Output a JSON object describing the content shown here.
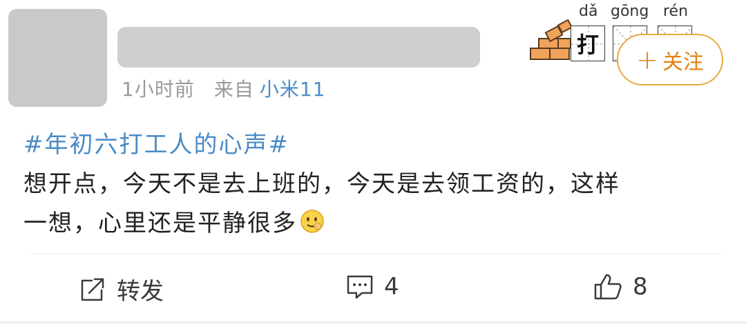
{
  "post": {
    "time": "1小时前",
    "from_label": "来自",
    "device": "小米11",
    "hashtag": "#年初六打工人的心声#",
    "text_line1": "想开点，今天不是去上班的，今天是去领工资的，这样",
    "text_line2": "一想，心里还是平静很多"
  },
  "badge": {
    "pinyin": [
      "dǎ",
      "gōng",
      "rén"
    ],
    "chars": [
      "打",
      "",
      ""
    ]
  },
  "follow": {
    "plus": "+",
    "label": "关注"
  },
  "actions": {
    "repost_label": "转发",
    "comment_count": "4",
    "like_count": "8"
  },
  "colors": {
    "link": "#4a8bc6",
    "follow_orange": "#e27f12",
    "follow_border": "#e9a93f",
    "meta_gray": "#9a9a9a"
  },
  "icons": [
    "brick-wall-icon",
    "smile-emoji-icon",
    "repost-icon",
    "comment-icon",
    "like-icon"
  ]
}
